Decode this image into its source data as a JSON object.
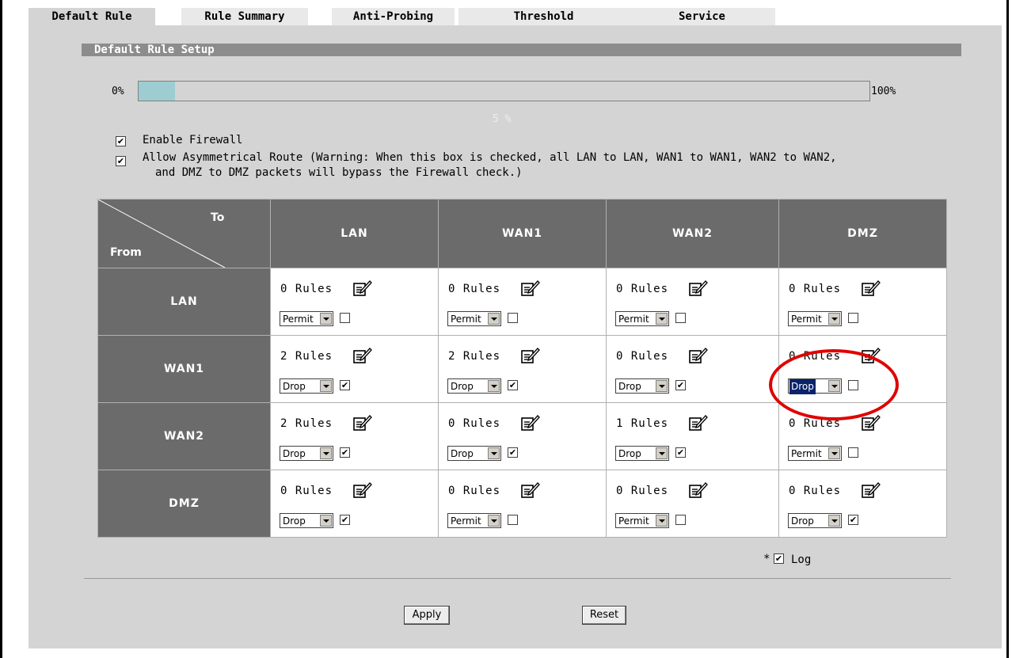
{
  "tabs": [
    {
      "label": "Default Rule",
      "active": true
    },
    {
      "label": "Rule Summary",
      "active": false
    },
    {
      "label": "Anti-Probing",
      "active": false
    },
    {
      "label": "Threshold",
      "active": false
    },
    {
      "label": "Service",
      "active": false
    }
  ],
  "section_title": "Default Rule Setup",
  "progress": {
    "min_label": "0%",
    "max_label": "100%",
    "value": 5,
    "caption": "5 %",
    "fill_color": "#9dcdd1"
  },
  "options": {
    "enable_firewall": {
      "label": "Enable Firewall",
      "checked": true
    },
    "asym_route": {
      "checked": true,
      "line1": "Allow Asymmetrical Route (Warning: When this box is checked, all LAN to LAN, WAN1 to WAN1, WAN2 to WAN2,",
      "line2": "and DMZ to DMZ packets will bypass the Firewall check.)"
    }
  },
  "matrix": {
    "to_label": "To",
    "from_label": "From",
    "columns": [
      "LAN",
      "WAN1",
      "WAN2",
      "DMZ"
    ],
    "rows": [
      {
        "label": "LAN",
        "cells": [
          {
            "rules": "0  Rules",
            "action": "Permit",
            "log": false
          },
          {
            "rules": "0  Rules",
            "action": "Permit",
            "log": false
          },
          {
            "rules": "0  Rules",
            "action": "Permit",
            "log": false
          },
          {
            "rules": "0  Rules",
            "action": "Permit",
            "log": false
          }
        ]
      },
      {
        "label": "WAN1",
        "cells": [
          {
            "rules": "2  Rules",
            "action": "Drop",
            "log": true
          },
          {
            "rules": "2  Rules",
            "action": "Drop",
            "log": true
          },
          {
            "rules": "0  Rules",
            "action": "Drop",
            "log": true
          },
          {
            "rules": "0  Rules",
            "action": "Drop",
            "log": false,
            "highlighted": true
          }
        ]
      },
      {
        "label": "WAN2",
        "cells": [
          {
            "rules": "2  Rules",
            "action": "Drop",
            "log": true
          },
          {
            "rules": "0  Rules",
            "action": "Drop",
            "log": true
          },
          {
            "rules": "1  Rules",
            "action": "Drop",
            "log": true
          },
          {
            "rules": "0  Rules",
            "action": "Permit",
            "log": false
          }
        ]
      },
      {
        "label": "DMZ",
        "cells": [
          {
            "rules": "0  Rules",
            "action": "Drop",
            "log": true
          },
          {
            "rules": "0  Rules",
            "action": "Permit",
            "log": false
          },
          {
            "rules": "0  Rules",
            "action": "Permit",
            "log": false
          },
          {
            "rules": "0  Rules",
            "action": "Drop",
            "log": true
          }
        ]
      }
    ]
  },
  "log_legend": {
    "prefix": "*",
    "label": "Log",
    "checked": true
  },
  "buttons": {
    "apply": "Apply",
    "reset": "Reset"
  },
  "icons": {
    "edit": "edit-rules-icon"
  },
  "annotation": {
    "color": "#e00000"
  }
}
